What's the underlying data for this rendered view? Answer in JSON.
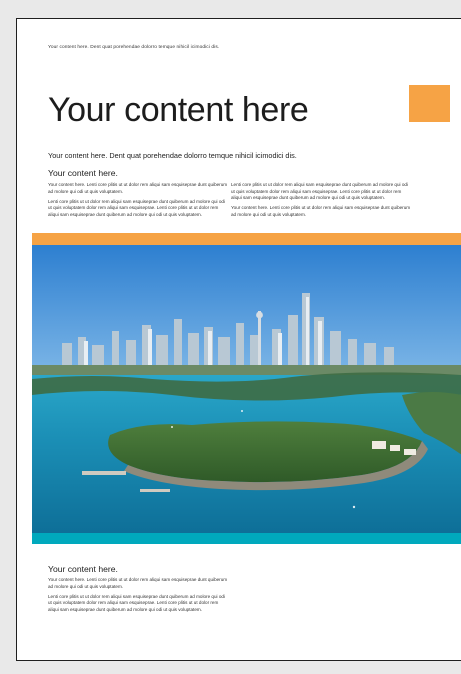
{
  "document": {
    "top_note": "Your content here. Dent quat porehendae dolorro temque nihicil icimodici dis.",
    "title": "Your content here",
    "subtitle": "Your content here. Dent quat porehendae dolorro temque nihicil icimodici dis.",
    "intro": {
      "heading": "Your content here.",
      "col_left": [
        "Your content here. Lenti core plitis ut ut dolor rem aliqui sam esquiseprae dunt quiberum ad molore qui odi ut quis voluptatem.",
        "Lenti core plitis ut ut dolor rem aliqui sam esquiseprae dunt quiberum ad molore qui odi ut quis voluptatem dolor rem aliqui sam esquiseprae. Lenti core plitis ut ut dolor rem aliqui sam esquiseprae dunt quiberum ad molore qui odi ut quis voluptatem."
      ],
      "col_right": [
        "Lenti core plitis ut ut dolor rem aliqui sam esquiseprae dunt quiberum ad molore qui odi ut quis voluptatem dolor rem aliqui sam esquiseprae. Lenti core plitis ut ut dolor rem aliqui sam esquiseprae dunt quiberum ad molore qui odi ut quis voluptatem.",
        "Your content here. Lenti core plitis ut ut dolor rem aliqui sam esquiseprae dunt quiberum ad molore qui odi ut quis voluptatem."
      ]
    },
    "footer": {
      "heading": "Your content here.",
      "paragraphs": [
        "Your content here. Lenti core plitis ut ut dolor rem aliqui sam esquiseprae dunt quiberum ad molore qui odi ut quis voluptatem.",
        "Lenti core plitis ut ut dolor rem aliqui sam esquiseprae dunt quiberum ad molore qui odi ut quis voluptatem dolor rem aliqui sam esquiseprae. Lenti core plitis ut ut dolor rem aliqui sam esquiseprae dunt quiberum ad molore qui odi ut quis voluptatem."
      ]
    }
  },
  "colors": {
    "accent_orange": "#f6a345",
    "accent_teal": "#00a9bd",
    "text_dark": "#1d1d1d"
  }
}
